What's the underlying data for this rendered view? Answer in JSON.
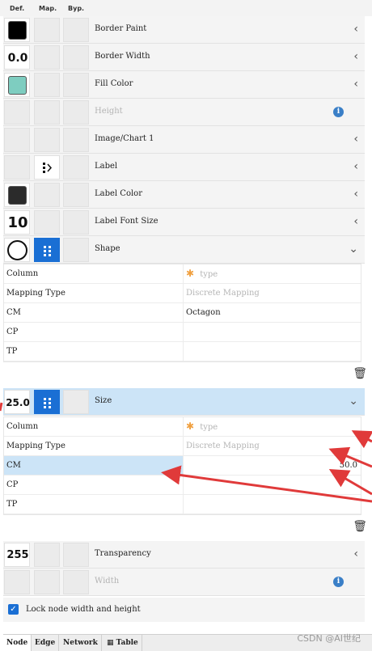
{
  "header": {
    "col_def": "Def.",
    "col_map": "Map.",
    "col_byp": "Byp."
  },
  "properties": {
    "border_paint": {
      "label": "Border Paint",
      "swatch": "#000000"
    },
    "border_width": {
      "label": "Border Width",
      "value": "0.0"
    },
    "fill_color": {
      "label": "Fill Color",
      "swatch": "#7ecdc0"
    },
    "height": {
      "label": "Height"
    },
    "image_chart": {
      "label": "Image/Chart 1"
    },
    "label": {
      "label": "Label"
    },
    "label_color": {
      "label": "Label Color",
      "swatch": "#2b2b2b"
    },
    "label_font_size": {
      "label": "Label Font Size",
      "value": "10"
    },
    "shape": {
      "label": "Shape"
    },
    "size": {
      "label": "Size",
      "value": "25.0"
    },
    "transparency": {
      "label": "Transparency",
      "value": "255"
    },
    "width": {
      "label": "Width"
    }
  },
  "shape_mapping": {
    "rows": [
      {
        "key": "Column",
        "value": "type"
      },
      {
        "key": "Mapping Type",
        "value": "Discrete Mapping"
      },
      {
        "key": "CM",
        "value": "Octagon"
      },
      {
        "key": "CP",
        "value": ""
      },
      {
        "key": "TP",
        "value": ""
      }
    ]
  },
  "size_mapping": {
    "rows": [
      {
        "key": "Column",
        "value": "type"
      },
      {
        "key": "Mapping Type",
        "value": "Discrete Mapping"
      },
      {
        "key": "CM",
        "value": "50.0"
      },
      {
        "key": "CP",
        "value": ""
      },
      {
        "key": "TP",
        "value": ""
      }
    ]
  },
  "lock": {
    "label": "Lock node width and height",
    "checked": true
  },
  "tabs": [
    "Node",
    "Edge",
    "Network",
    "Table"
  ],
  "watermark": "CSDN @AI世纪",
  "colors": {
    "accent": "#1a6fd4",
    "selection": "#cce4f7",
    "annotation": "#e03a3a"
  }
}
